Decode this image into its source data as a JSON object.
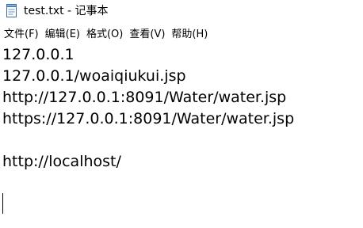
{
  "window": {
    "title": "test.txt - 记事本",
    "icon": "notepad-icon"
  },
  "menu": [
    {
      "label": "文件(F)"
    },
    {
      "label": "编辑(E)"
    },
    {
      "label": "格式(O)"
    },
    {
      "label": "查看(V)"
    },
    {
      "label": "帮助(H)"
    }
  ],
  "editor": {
    "lines": [
      "127.0.0.1",
      "127.0.0.1/woaiqiukui.jsp",
      "http://127.0.0.1:8091/Water/water.jsp",
      "https://127.0.0.1:8091/Water/water.jsp",
      "",
      "http://localhost/",
      ""
    ]
  }
}
